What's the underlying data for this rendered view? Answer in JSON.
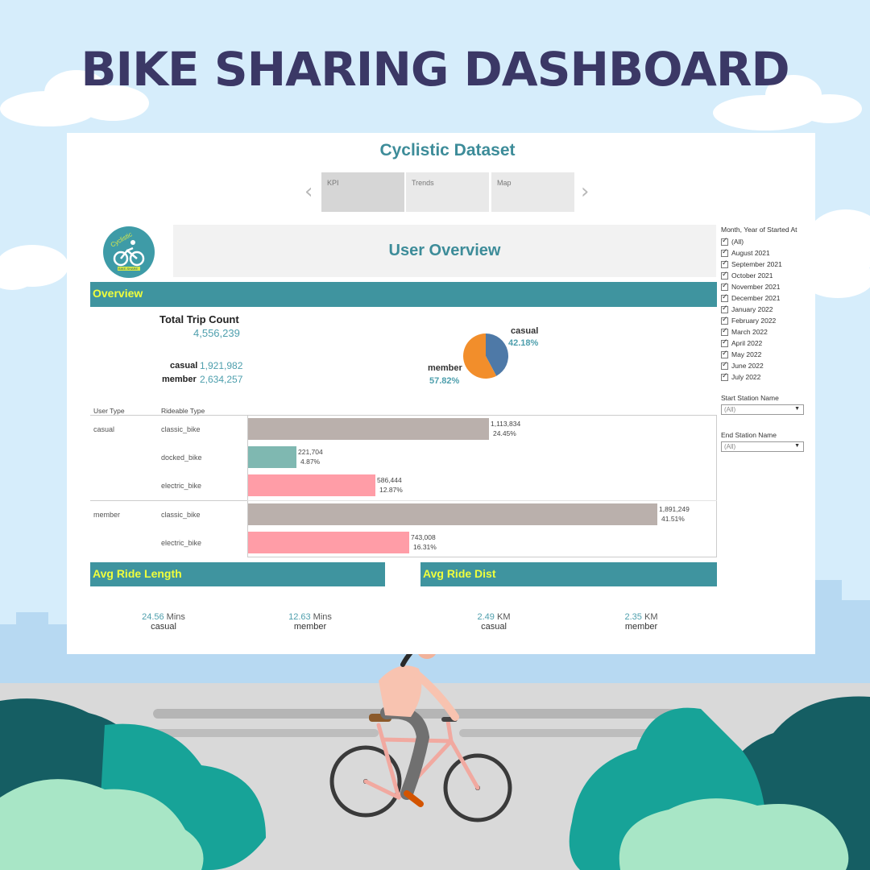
{
  "page_title": "BIKE SHARING DASHBOARD",
  "dataset_title": "Cyclistic Dataset",
  "tabs": [
    {
      "label": "KPI",
      "active": true
    },
    {
      "label": "Trends",
      "active": false
    },
    {
      "label": "Map",
      "active": false
    }
  ],
  "nav": {
    "prev_icon": "‹",
    "next_icon": "›"
  },
  "logo": {
    "text_top": "Cyclistic",
    "text_bottom": "BIKE-SHARE"
  },
  "header_box": "User Overview",
  "overview": {
    "label": "Overview",
    "total_trip_label": "Total Trip Count",
    "total_trip_value": "4,556,239",
    "casual_label": "casual",
    "casual_value": "1,921,982",
    "member_label": "member",
    "member_value": "2,634,257",
    "pie": {
      "casual_label": "casual",
      "casual_pct": "42.18%",
      "casual_value": 42.18,
      "casual_color": "#4e79a7",
      "member_label": "member",
      "member_pct": "57.82%",
      "member_value": 57.82,
      "member_color": "#f28e2b"
    }
  },
  "table": {
    "col_user_type": "User Type",
    "col_rideable_type": "Rideable Type",
    "max_value": 1891249,
    "rows": [
      {
        "user": "casual",
        "type": "classic_bike",
        "value": 1113834,
        "value_label": "1,113,834",
        "pct": "24.45%",
        "color": "#bab0ac"
      },
      {
        "user": "",
        "type": "docked_bike",
        "value": 221704,
        "value_label": "221,704",
        "pct": "4.87%",
        "color": "#7fb8b1"
      },
      {
        "user": "",
        "type": "electric_bike",
        "value": 586444,
        "value_label": "586,444",
        "pct": "12.87%",
        "color": "#ff9da7"
      },
      {
        "user": "member",
        "type": "classic_bike",
        "value": 1891249,
        "value_label": "1,891,249",
        "pct": "41.51%",
        "color": "#bab0ac"
      },
      {
        "user": "",
        "type": "electric_bike",
        "value": 743008,
        "value_label": "743,008",
        "pct": "16.31%",
        "color": "#ff9da7"
      }
    ]
  },
  "avg_ride_length": {
    "label": "Avg Ride Length",
    "casual_value": "24.56",
    "casual_unit": "Mins",
    "casual_label": "casual",
    "member_value": "12.63",
    "member_unit": "Mins",
    "member_label": "member"
  },
  "avg_ride_dist": {
    "label": "Avg Ride Dist",
    "casual_value": "2.49",
    "casual_unit": "KM",
    "casual_label": "casual",
    "member_value": "2.35",
    "member_unit": "KM",
    "member_label": "member"
  },
  "filters": {
    "month_label": "Month, Year of Started At",
    "months": [
      "(All)",
      "August 2021",
      "September 2021",
      "October 2021",
      "November 2021",
      "December 2021",
      "January 2022",
      "February 2022",
      "March 2022",
      "April 2022",
      "May 2022",
      "June 2022",
      "July 2022"
    ],
    "start_station_label": "Start Station Name",
    "start_station_value": "(All)",
    "end_station_label": "End Station Name",
    "end_station_value": "(All)",
    "dropdown_icon": "▼"
  }
}
